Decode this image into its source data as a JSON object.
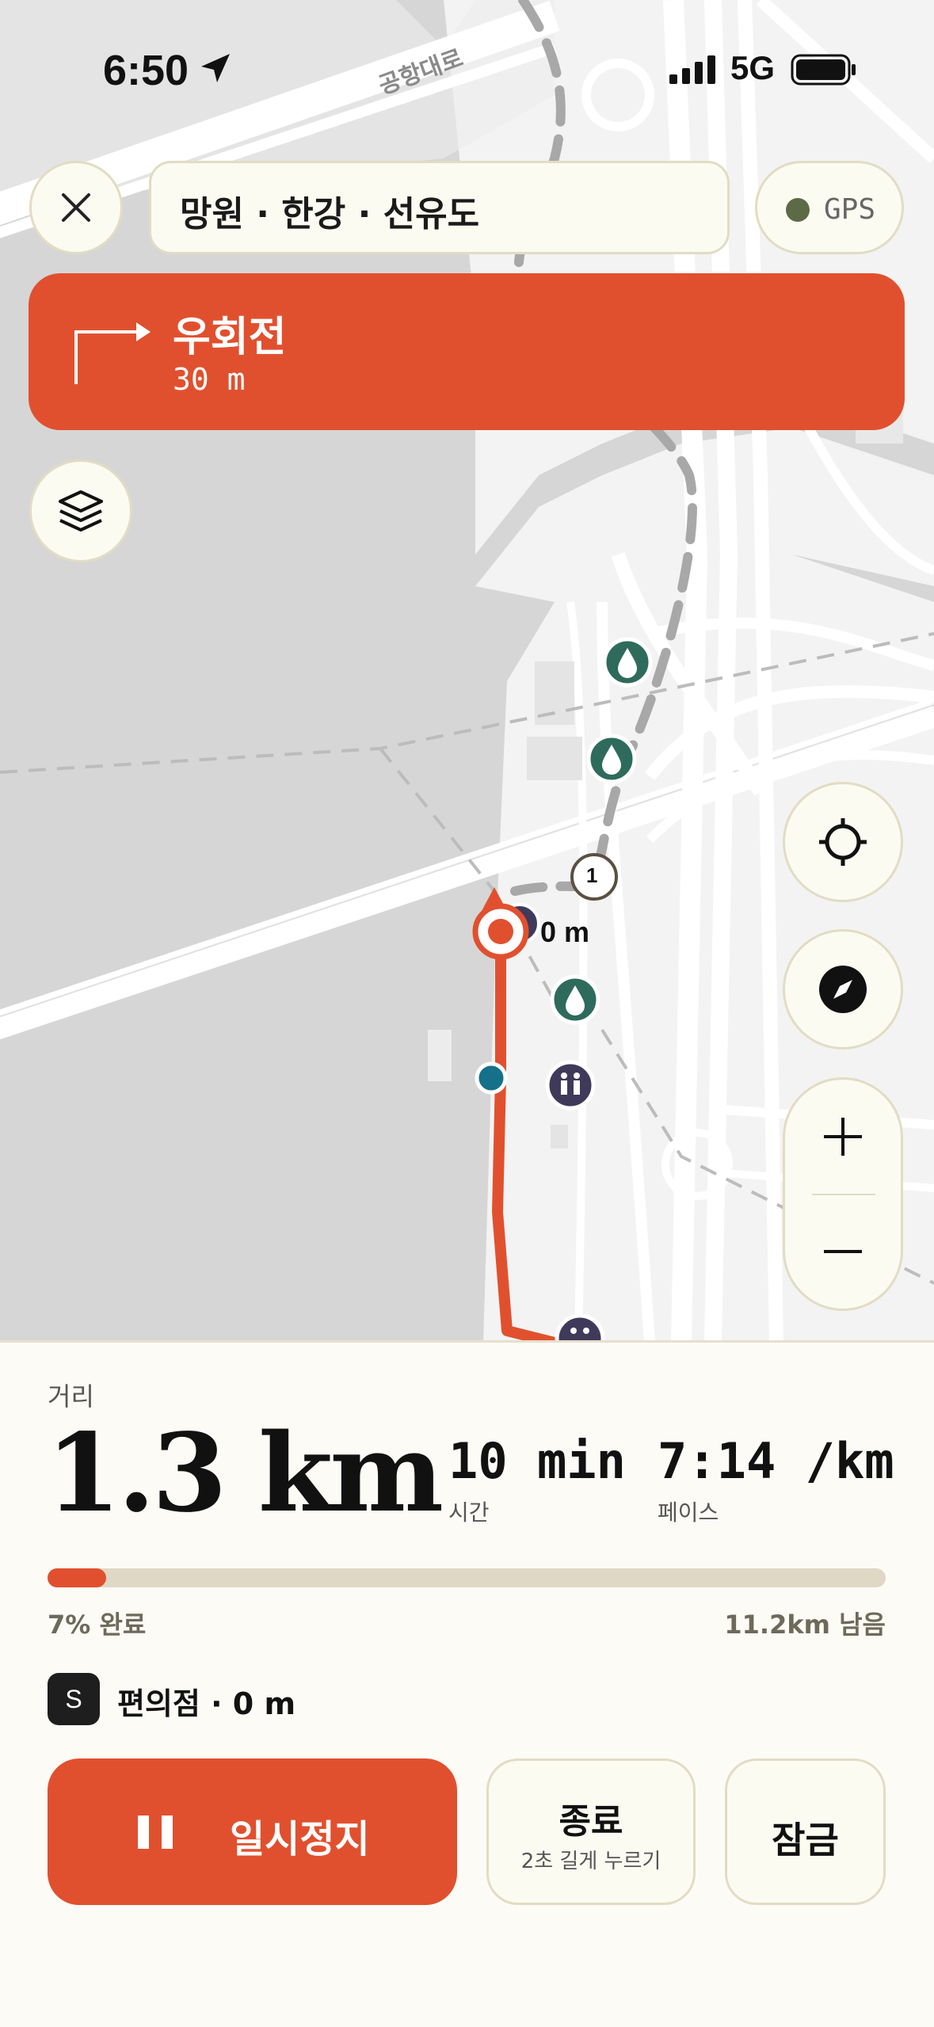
{
  "status_bar": {
    "time": "6:50",
    "network": "5G"
  },
  "map": {
    "road_label": "공항대로",
    "waypoint_number": "1",
    "distance_tag": "0 m"
  },
  "search": {
    "value": "망원 · 한강 · 선유도"
  },
  "gps": {
    "label": "GPS",
    "status_color": "#5c6b46"
  },
  "navigation": {
    "instruction": "우회전",
    "distance": "30 m"
  },
  "stats": {
    "distance_label": "거리",
    "distance_value": "1.3 km",
    "time_value": "10 min",
    "time_label": "시간",
    "pace_value": "7:14 /km",
    "pace_label": "페이스"
  },
  "progress": {
    "percent": 7,
    "completed_text": "7% 완료",
    "remaining_text": "11.2km 남음"
  },
  "nearby": {
    "badge": "S",
    "text": "편의점 · 0 m"
  },
  "controls": {
    "pause_label": "일시정지",
    "end_label": "종료",
    "end_hint": "2초 길게 누르기",
    "lock_label": "잠금"
  },
  "colors": {
    "accent": "#e1502e",
    "water_icon": "#2e6b5c",
    "restroom_icon": "#3f3a5a",
    "cream": "#fcfbf2"
  }
}
